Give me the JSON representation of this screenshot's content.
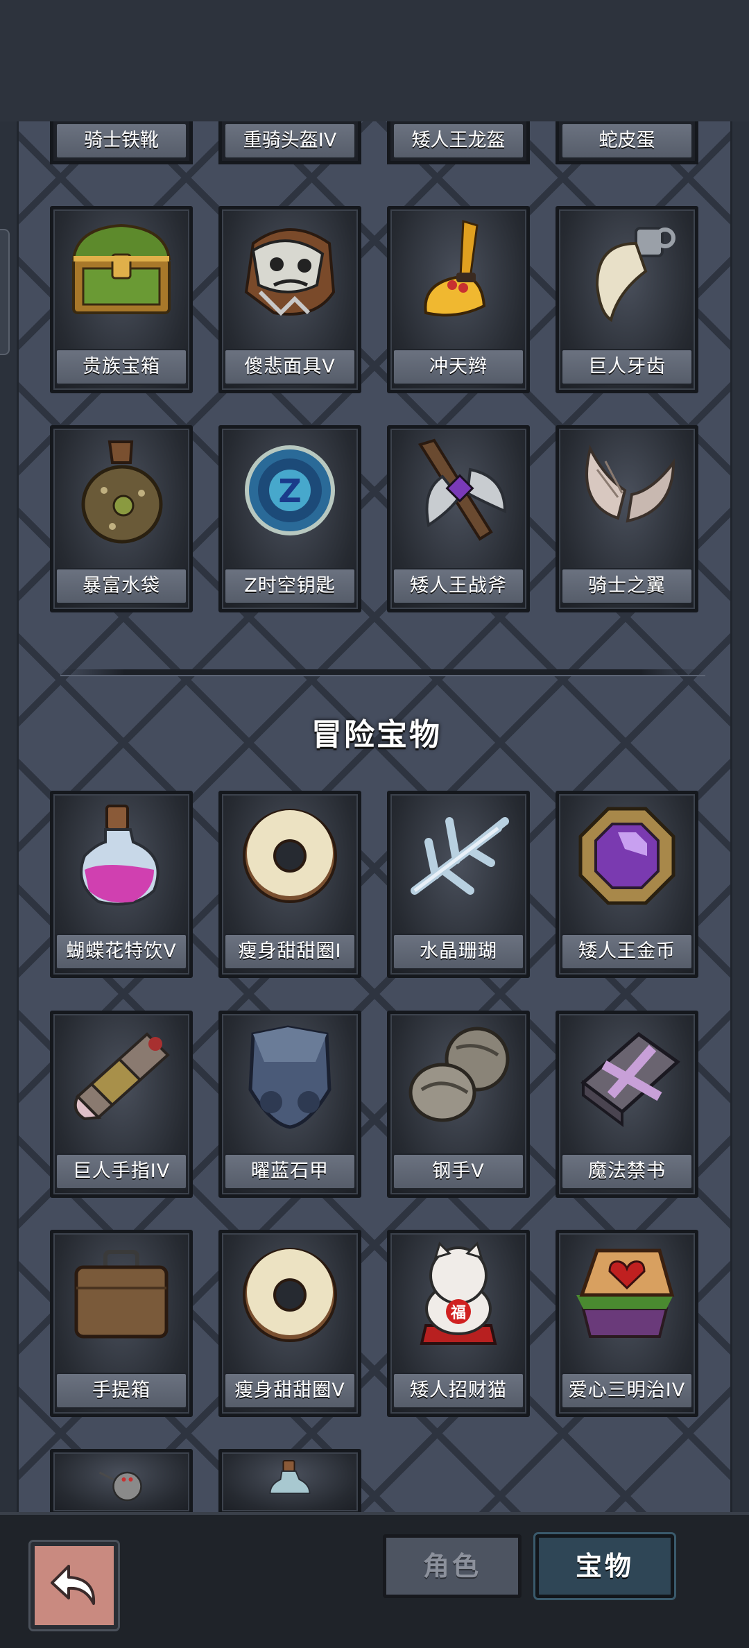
{
  "top_row_labels": [
    "骑士铁靴",
    "重骑头盔IV",
    "矮人王龙盔",
    "蛇皮蛋"
  ],
  "section1_items": [
    {
      "label": "贵族宝箱",
      "icon": "treasure-chest-icon"
    },
    {
      "label": "傻悲面具V",
      "icon": "sad-mask-icon"
    },
    {
      "label": "冲天辫",
      "icon": "ponytail-icon"
    },
    {
      "label": "巨人牙齿",
      "icon": "giant-tooth-icon"
    },
    {
      "label": "暴富水袋",
      "icon": "water-pouch-icon"
    },
    {
      "label": "Z时空钥匙",
      "icon": "z-spacetime-key-icon"
    },
    {
      "label": "矮人王战斧",
      "icon": "battle-axe-icon"
    },
    {
      "label": "骑士之翼",
      "icon": "wings-icon"
    }
  ],
  "section_title": "冒险宝物",
  "section2_items": [
    {
      "label": "蝴蝶花特饮V",
      "icon": "potion-icon"
    },
    {
      "label": "瘦身甜甜圈I",
      "icon": "donut-icon"
    },
    {
      "label": "水晶珊瑚",
      "icon": "crystal-coral-icon"
    },
    {
      "label": "矮人王金币",
      "icon": "gold-coin-icon"
    },
    {
      "label": "巨人手指IV",
      "icon": "giant-finger-icon"
    },
    {
      "label": "曜蓝石甲",
      "icon": "armor-icon"
    },
    {
      "label": "钢手V",
      "icon": "steel-gauntlet-icon"
    },
    {
      "label": "魔法禁书",
      "icon": "forbidden-book-icon"
    },
    {
      "label": "手提箱",
      "icon": "suitcase-icon"
    },
    {
      "label": "瘦身甜甜圈V",
      "icon": "donut-icon"
    },
    {
      "label": "矮人招财猫",
      "icon": "lucky-cat-icon"
    },
    {
      "label": "爱心三明治IV",
      "icon": "heart-sandwich-icon"
    }
  ],
  "partial_items": [
    {
      "icon": "mechanical-device-icon"
    },
    {
      "icon": "bottle-icon"
    }
  ],
  "tabs": {
    "roles": "角色",
    "treasure": "宝物"
  },
  "lucky_cat_char": "福",
  "key_letter": "Z",
  "colors": {
    "panel": "#454d5e",
    "label": "#626977",
    "active_tab": "#2f4656",
    "back_button": "#c98a80"
  }
}
